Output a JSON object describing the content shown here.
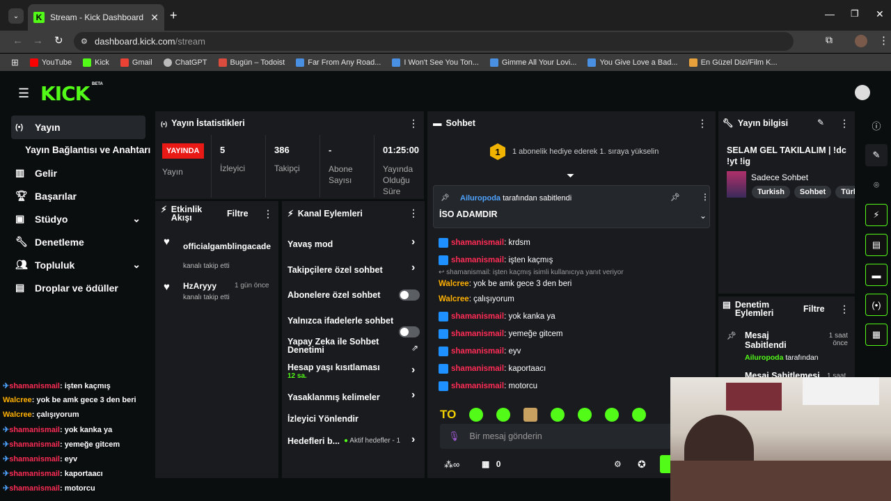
{
  "browser": {
    "tab_title": "Stream - Kick Dashboard",
    "url_host": "dashboard.kick.com",
    "url_path": "/stream",
    "bookmarks": [
      "YouTube",
      "Kick",
      "Gmail",
      "ChatGPT",
      "Bugün – Todoist",
      "Far From Any Road...",
      "I Won't See You Ton...",
      "Gimme All Your Lovi...",
      "You Give Love a Bad...",
      "En Güzel Dizi/Film K..."
    ]
  },
  "brand": {
    "logo": "KICK",
    "beta": "BETA"
  },
  "sidebar": {
    "items": [
      {
        "label": "Yayın",
        "icon": "broadcast-icon"
      },
      {
        "label": "Yayın Bağlantısı ve Anahtarı",
        "icon": ""
      },
      {
        "label": "Gelir",
        "icon": "chart-icon"
      },
      {
        "label": "Başarılar",
        "icon": "trophy-icon"
      },
      {
        "label": "Stüdyo",
        "icon": "studio-icon"
      },
      {
        "label": "Denetleme",
        "icon": "wrench-icon"
      },
      {
        "label": "Topluluk",
        "icon": "community-icon"
      },
      {
        "label": "Droplar ve ödüller",
        "icon": "gift-icon"
      }
    ]
  },
  "stats": {
    "title": "Yayın İstatistikleri",
    "live_badge": "YAYINDA",
    "live_label": "Yayın",
    "viewers_value": "5",
    "viewers_label": "İzleyici",
    "followers_value": "386",
    "followers_label": "Takipçi",
    "subs_value": "-",
    "subs_label": "Abone Sayısı",
    "time_value": "01:25:00",
    "time_label": "Yayında Olduğu Süre"
  },
  "activity": {
    "title": "Etkinlik Akışı",
    "filter": "Filtre",
    "events": [
      {
        "user": "officialgamblingacade",
        "time": "",
        "text": "kanalı takip etti"
      },
      {
        "user": "HzAryyy",
        "time": "1 gün önce",
        "text": "kanalı takip etti"
      }
    ]
  },
  "channel_actions": {
    "title": "Kanal Eylemleri",
    "items": {
      "slow": "Yavaş mod",
      "followers": "Takipçilere özel sohbet",
      "subs": "Abonelere özel sohbet",
      "emotes": "Yalnızca ifadelerle sohbet",
      "ai_l1": "Yapay Zeka ile Sohbet",
      "ai_l2": "Denetimi",
      "age": "Hesap yaşı kısıtlaması",
      "age_value": "12 sa.",
      "banned": "Yasaklanmış kelimeler",
      "raid": "İzleyici Yönlendir",
      "goals": "Hedefleri b...",
      "goals_status": "Aktif hedefler - 1"
    }
  },
  "chat": {
    "title": "Sohbet",
    "gift_rank": "1",
    "gift_text": "1 abonelik hediye ederek 1. sıraya yükselin",
    "pinned_by_user": "Ailuropoda",
    "pinned_by_text": "tarafından sabitlendi",
    "pinned_message": "İSO ADAMDIR",
    "reply_note": "shamanismail: işten kaçmış isimli kullanıcıya yanıt veriyor",
    "messages": [
      {
        "user": "shamanismail",
        "text": ": krdsm"
      },
      {
        "user": "shamanismail",
        "text": ": işten kaçmış"
      },
      {
        "user": "Walcree",
        "text": ": yok be amk gece 3 den beri"
      },
      {
        "user": "Walcree",
        "text": ": çalışıyorum"
      },
      {
        "user": "shamanismail",
        "text": ": yok kanka ya"
      },
      {
        "user": "shamanismail",
        "text": ": yemeğe gitcem"
      },
      {
        "user": "shamanismail",
        "text": ": eyv"
      },
      {
        "user": "shamanismail",
        "text": ": kaportaacı"
      },
      {
        "user": "shamanismail",
        "text": ": motorcu"
      }
    ],
    "emote_first": "TO",
    "input_placeholder": "Bir mesaj gönderin",
    "points": "0"
  },
  "stream_info": {
    "title": "Yayın bilgisi",
    "stream_title": "SELAM GEL TAKILALIM | !dc !yt !ig",
    "category": "Sadece Sohbet",
    "tags": [
      "Turkish",
      "Sohbet",
      "Türk"
    ]
  },
  "mod_actions": {
    "title": "Denetim Eylemleri",
    "filter": "Filtre",
    "item_title": "Mesaj Sabitlendi",
    "item_time": "1 saat önce",
    "item_by_user": "Ailuropoda",
    "item_by_text": "tarafından",
    "item2_title": "Mesaj Sabitlemesi",
    "item2_time": "1 saat"
  },
  "overlay_chat": [
    {
      "user": "shamanismail",
      "text": ": işten kaçmış"
    },
    {
      "user": "Walcree",
      "text": ": yok be amk gece 3 den beri"
    },
    {
      "user": "Walcree",
      "text": ": çalışıyorum"
    },
    {
      "user": "shamanismail",
      "text": ": yok kanka ya"
    },
    {
      "user": "shamanismail",
      "text": ": yemeğe gitcem"
    },
    {
      "user": "shamanismail",
      "text": ": eyv"
    },
    {
      "user": "shamanismail",
      "text": ": kaportaacı"
    },
    {
      "user": "shamanismail",
      "text": ": motorcu"
    }
  ],
  "colors": {
    "accent": "#53fc18",
    "live": "#e91916",
    "mod_user": "#ff2c55",
    "vip_user": "#ffb000"
  }
}
